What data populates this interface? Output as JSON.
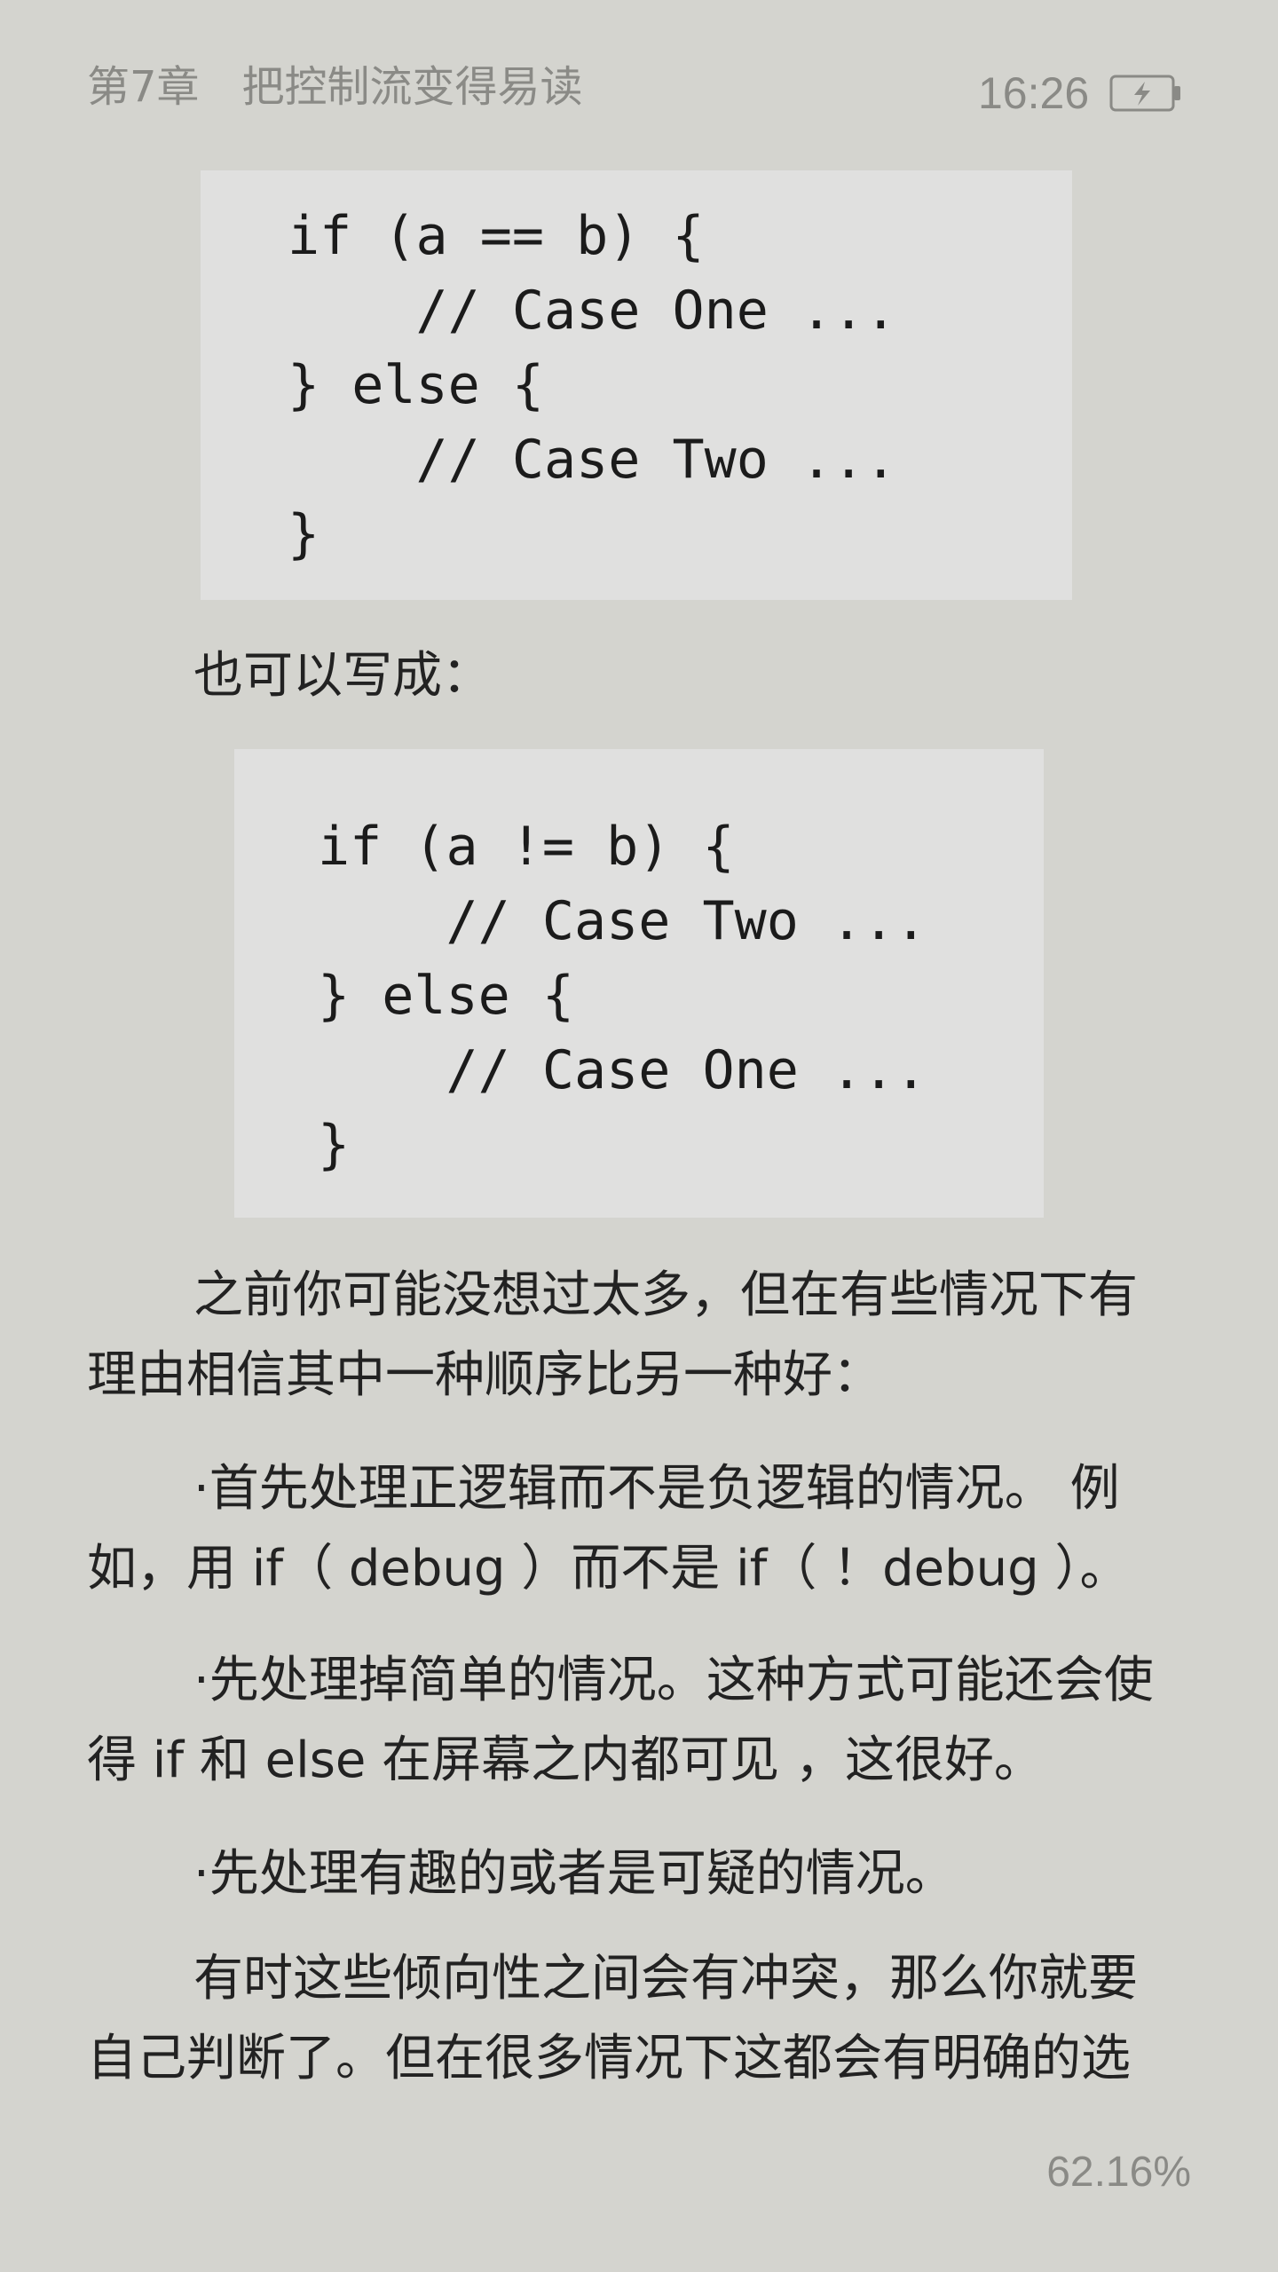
{
  "header": {
    "chapter": "第7章　把控制流变得易读",
    "time": "16:26",
    "battery_icon": "charging-battery-icon"
  },
  "code_examples": [
    {
      "lines": [
        "if (a == b) {",
        "    // Case One ...",
        "} else {",
        "    // Case Two ...",
        "}"
      ]
    },
    {
      "lines": [
        "if (a != b) {",
        "    // Case Two ...",
        "} else {",
        "    // Case One ...",
        "}"
      ]
    }
  ],
  "text": {
    "also_write": "也可以写成：",
    "p1_line1": "之前你可能没想过太多，但在有些情况下有",
    "p1_line2": "理由相信其中一种顺序比另一种好：",
    "b1_line1": "·首先处理正逻辑而不是负逻辑的情况。 例",
    "b1_line2": "如，用 if（ debug ）而不是 if（ ！debug ）。",
    "b2_line1": "·先处理掉简单的情况。这种方式可能还会使",
    "b2_line2": "得 if 和 else 在屏幕之内都可见 ，这很好。",
    "b3_line1": "·先处理有趣的或者是可疑的情况。",
    "p2_line1": "有时这些倾向性之间会有冲突，那么你就要",
    "p2_line2": "自己判断了。但在很多情况下这都会有明确的选"
  },
  "footer": {
    "progress": "62.16%"
  },
  "colors": {
    "background": "#d4d4cf",
    "code_background": "#e0e0df",
    "header_text": "#8a8a86"
  }
}
